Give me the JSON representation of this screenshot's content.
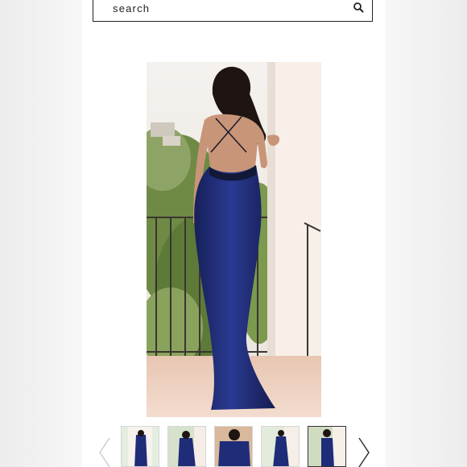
{
  "search": {
    "label": "search"
  },
  "icons": {
    "search": "magnifier-icon",
    "prev": "chevron-left-icon",
    "next": "chevron-right-icon"
  },
  "gallery": {
    "main_image": "woman-in-navy-backless-gown-photo",
    "thumbnail_count": 5,
    "active_thumbnail": 5
  },
  "colors": {
    "dress": "#1d2a6e",
    "accent_border": "#333333"
  }
}
